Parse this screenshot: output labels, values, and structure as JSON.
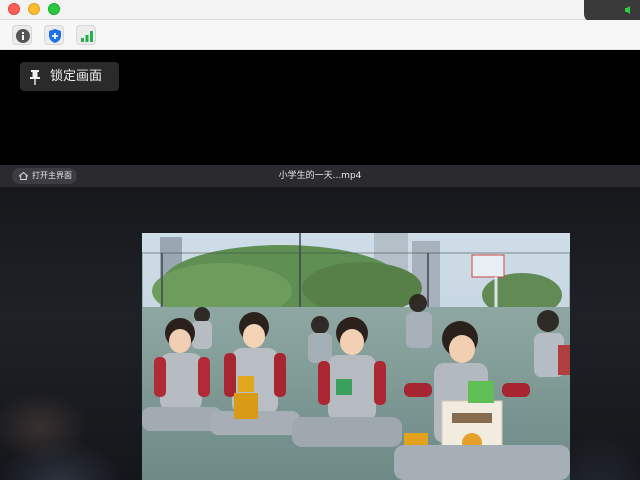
{
  "window": {
    "controls": [
      "close",
      "minimize",
      "maximize"
    ],
    "corner_icon": "speaker-icon"
  },
  "toolbar": {
    "buttons": [
      {
        "icon": "info-icon"
      },
      {
        "icon": "shield-icon"
      },
      {
        "icon": "signal-bars-icon"
      }
    ]
  },
  "lock_button": {
    "label": "锁定画面",
    "icon": "pin-icon"
  },
  "video_header": {
    "back_button": {
      "label": "打开主界面",
      "icon": "home-icon"
    },
    "title": "小学生的一天...mp4"
  },
  "colors": {
    "close": "#ff5f57",
    "minimize": "#febc2e",
    "maximize": "#28c840",
    "shield_blue": "#1f6fe5",
    "signal_green": "#22b14c",
    "speaker_green": "#2ecc40"
  }
}
